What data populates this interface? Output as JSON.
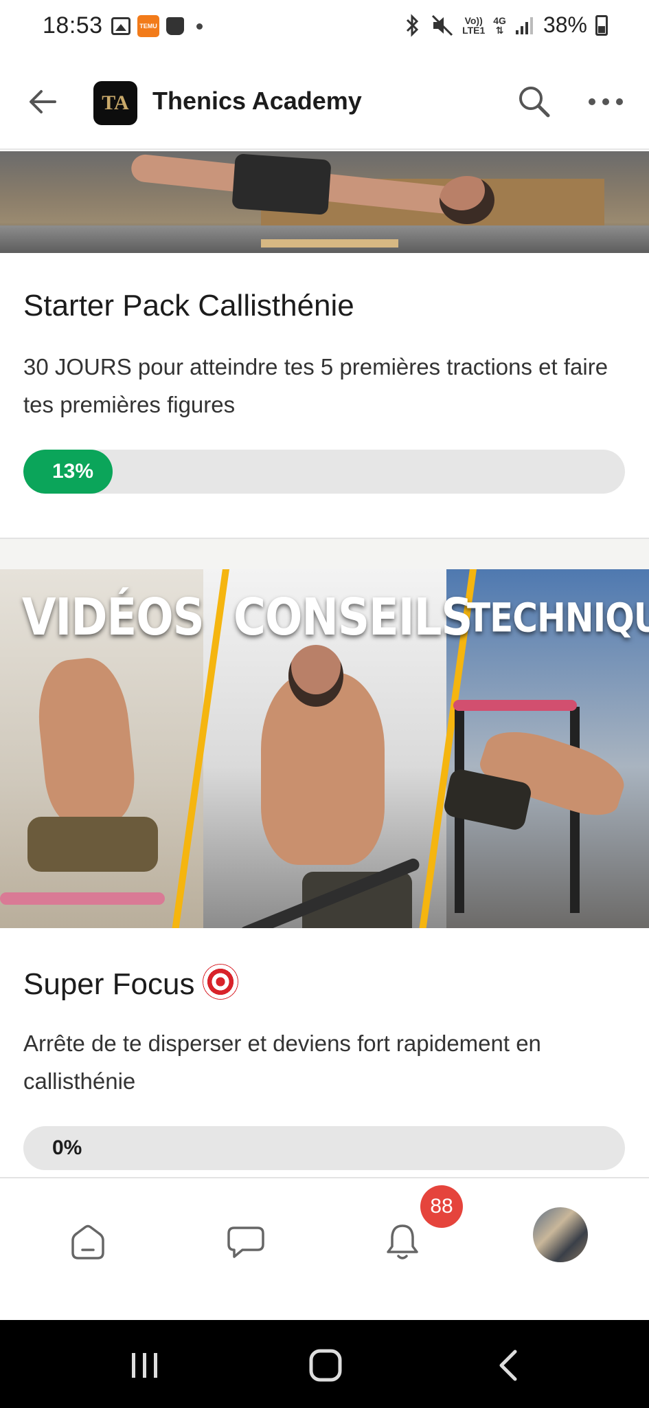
{
  "status_bar": {
    "time": "18:53",
    "temu_label": "TEMU",
    "network_top": "Vo))",
    "network_bottom": "LTE1",
    "data_type": "4G",
    "battery": "38%"
  },
  "header": {
    "app_name": "Thenics Academy",
    "logo_text": "TA"
  },
  "cards": [
    {
      "title": "Starter Pack Callisthénie",
      "description": "30 JOURS pour atteindre tes 5 premières tractions et faire tes premières figures",
      "progress_percent": 13,
      "progress_label": "13%",
      "accent_color": "#0ba55a"
    },
    {
      "title": "Super Focus",
      "title_emoji": "direct-hit-icon",
      "banner_words": [
        "VIDÉOS",
        "CONSEILS",
        "TECHNIQUE"
      ],
      "description": "Arrête de te disperser et deviens fort rapidement en callisthénie",
      "progress_percent": 0,
      "progress_label": "0%"
    }
  ],
  "bottom_nav": {
    "items": [
      "home-icon",
      "chat-icon",
      "bell-icon",
      "profile-avatar"
    ],
    "notification_count": "88",
    "badge_color": "#e5443c"
  }
}
